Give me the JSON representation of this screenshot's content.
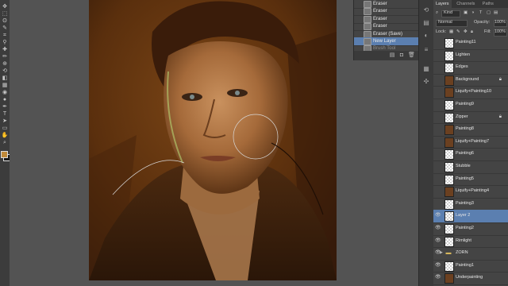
{
  "history": {
    "items": [
      {
        "label": "Eraser",
        "state": "normal"
      },
      {
        "label": "Eraser",
        "state": "normal"
      },
      {
        "label": "Eraser",
        "state": "normal"
      },
      {
        "label": "Eraser",
        "state": "normal"
      },
      {
        "label": "Eraser (Save)",
        "state": "normal"
      },
      {
        "label": "New Layer",
        "state": "selected"
      },
      {
        "label": "Brush Tool",
        "state": "dim"
      }
    ]
  },
  "layers_panel": {
    "tabs": [
      "Layers",
      "Channels",
      "Paths"
    ],
    "kind_label": "Kind",
    "blend_mode": "Normal",
    "opacity_label": "Opacity:",
    "opacity_value": "100%",
    "lock_label": "Lock:",
    "fill_label": "Fill:",
    "fill_value": "100%",
    "layers": [
      {
        "name": "Painting11",
        "thumb": "checker",
        "visible": false,
        "selected": false,
        "locked": false
      },
      {
        "name": "Lighten",
        "thumb": "checker",
        "visible": false,
        "selected": false,
        "locked": false
      },
      {
        "name": "Edges",
        "thumb": "checker",
        "visible": false,
        "selected": false,
        "locked": false
      },
      {
        "name": "Background",
        "thumb": "portrait",
        "visible": false,
        "selected": false,
        "locked": true
      },
      {
        "name": "Liquify+Painting10",
        "thumb": "portrait",
        "visible": false,
        "selected": false,
        "locked": false
      },
      {
        "name": "Painting9",
        "thumb": "checker",
        "visible": false,
        "selected": false,
        "locked": false
      },
      {
        "name": "Zipper",
        "thumb": "checker",
        "visible": false,
        "selected": false,
        "locked": true
      },
      {
        "name": "Painting8",
        "thumb": "portrait",
        "visible": false,
        "selected": false,
        "locked": false
      },
      {
        "name": "Liquify+Painting7",
        "thumb": "portrait",
        "visible": false,
        "selected": false,
        "locked": false
      },
      {
        "name": "Painting6",
        "thumb": "checker",
        "visible": false,
        "selected": false,
        "locked": false
      },
      {
        "name": "Stubble",
        "thumb": "checker",
        "visible": false,
        "selected": false,
        "locked": false
      },
      {
        "name": "Painting5",
        "thumb": "checker",
        "visible": false,
        "selected": false,
        "locked": false
      },
      {
        "name": "Liquify+Painting4",
        "thumb": "portrait",
        "visible": false,
        "selected": false,
        "locked": false
      },
      {
        "name": "Painting3",
        "thumb": "checker",
        "visible": false,
        "selected": false,
        "locked": false
      },
      {
        "name": "Layer 2",
        "thumb": "checker",
        "visible": true,
        "selected": true,
        "locked": false
      },
      {
        "name": "Painting2",
        "thumb": "checker",
        "visible": true,
        "selected": false,
        "locked": false
      },
      {
        "name": "Rimlight",
        "thumb": "checker",
        "visible": true,
        "selected": false,
        "locked": false
      },
      {
        "name": "ZORN",
        "thumb": "folder",
        "visible": true,
        "selected": false,
        "locked": false
      },
      {
        "name": "Painting1",
        "thumb": "checker",
        "visible": true,
        "selected": false,
        "locked": false
      },
      {
        "name": "Underpainting",
        "thumb": "portrait",
        "visible": true,
        "selected": false,
        "locked": false
      }
    ]
  },
  "tools": [
    "move-tool",
    "marquee-tool",
    "lasso-tool",
    "quick-select-tool",
    "crop-tool",
    "eyedropper-tool",
    "healing-tool",
    "brush-tool",
    "clone-tool",
    "history-brush-tool",
    "eraser-tool",
    "gradient-tool",
    "blur-tool",
    "dodge-tool",
    "pen-tool",
    "type-tool",
    "path-select-tool",
    "shape-tool",
    "hand-tool",
    "zoom-tool"
  ],
  "colors": {
    "foreground": "#c08a3a",
    "background": "#1a1a1a",
    "selection": "#5b7fb0"
  }
}
